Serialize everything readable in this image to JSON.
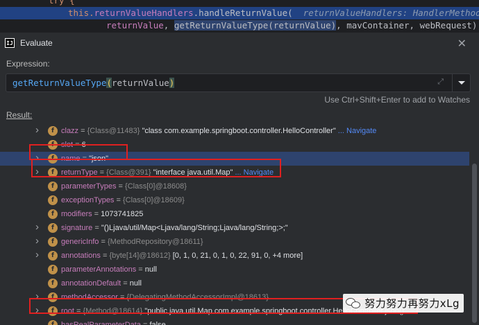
{
  "editor": {
    "line0": "try {",
    "line1_obj": "this.",
    "line1_field": "returnValueHandlers",
    "line1_call": ".handleReturnValue(",
    "line1_hint": "returnValueHandlers: HandlerMethodRetur",
    "line2_arg1": "returnValue",
    "line2_sep1": ", ",
    "line2_sel": "getReturnValueType(returnValue)",
    "line2_rest": ", mavContainer, webRequest);"
  },
  "dialog": {
    "logo": "IJ",
    "title": "Evaluate",
    "expression_label": "Expression:",
    "expression_fn": "getReturnValueType",
    "expression_open": "(",
    "expression_arg": "returnValue",
    "expression_close": ")",
    "watch_hint": "Use Ctrl+Shift+Enter to add to Watches",
    "result_label": "Result:"
  },
  "tree": {
    "rows": [
      {
        "name": "clazz",
        "ref": "{Class@11483}",
        "value": " \"class com.example.springboot.controller.HelloController\"",
        "nav": " ... Navigate",
        "expandable": true
      },
      {
        "name": "slot",
        "ref": "",
        "value": "6",
        "nav": "",
        "expandable": false
      },
      {
        "name": "name",
        "ref": "",
        "value": "\"json\"",
        "nav": "",
        "expandable": true
      },
      {
        "name": "returnType",
        "ref": "{Class@391}",
        "value": " \"interface java.util.Map\"",
        "nav": " ... Navigate",
        "expandable": true
      },
      {
        "name": "parameterTypes",
        "ref": "{Class[0]@18608}",
        "value": "",
        "nav": "",
        "expandable": false
      },
      {
        "name": "exceptionTypes",
        "ref": "{Class[0]@18609}",
        "value": "",
        "nav": "",
        "expandable": false
      },
      {
        "name": "modifiers",
        "ref": "",
        "value": "1073741825",
        "nav": "",
        "expandable": false
      },
      {
        "name": "signature",
        "ref": "",
        "value": "\"()Ljava/util/Map<Ljava/lang/String;Ljava/lang/String;>;\"",
        "nav": "",
        "expandable": true
      },
      {
        "name": "genericInfo",
        "ref": "{MethodRepository@18611}",
        "value": "",
        "nav": "",
        "expandable": true
      },
      {
        "name": "annotations",
        "ref": "{byte[14]@18612}",
        "value": " [0, 1, 0, 21, 0, 1, 0, 22, 91, 0, +4 more]",
        "nav": "",
        "expandable": true
      },
      {
        "name": "parameterAnnotations",
        "ref": "",
        "value": "null",
        "nav": "",
        "expandable": false
      },
      {
        "name": "annotationDefault",
        "ref": "",
        "value": "null",
        "nav": "",
        "expandable": false
      },
      {
        "name": "methodAccessor",
        "ref": "{DelegatingMethodAccessorImpl@18613}",
        "value": "",
        "nav": "",
        "expandable": true
      },
      {
        "name": "root",
        "ref": "{Method@18614}",
        "value": " \"public java.util.Map com.example.springboot.controller.HelloController.json()\"",
        "nav": "",
        "expandable": true
      },
      {
        "name": "hasRealParameterData",
        "ref": "",
        "value": "false",
        "nav": "",
        "expandable": false
      }
    ]
  },
  "watermark": {
    "text": "努力努力再努力xLg",
    "icon": "wechat-icon"
  },
  "colors": {
    "field_name": "#c77dbb",
    "field_icon": "#c09149",
    "selection": "#2e436e",
    "highlight_box": "#e02020",
    "navigate_link": "#548af7"
  }
}
